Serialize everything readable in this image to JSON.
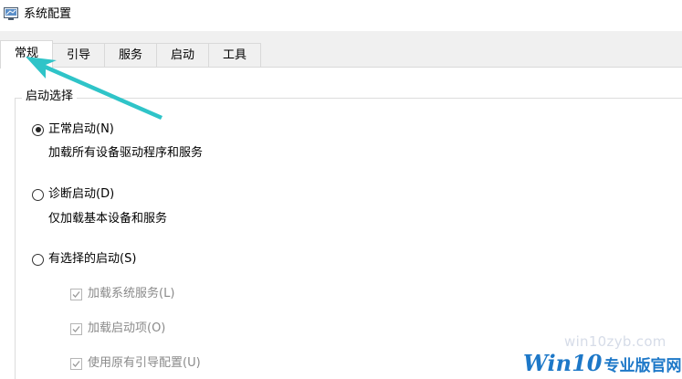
{
  "window": {
    "title": "系统配置",
    "icon": "system-config-icon"
  },
  "tabs": [
    {
      "label": "常规",
      "active": true
    },
    {
      "label": "引导",
      "active": false
    },
    {
      "label": "服务",
      "active": false
    },
    {
      "label": "启动",
      "active": false
    },
    {
      "label": "工具",
      "active": false
    }
  ],
  "startup_selection": {
    "legend": "启动选择",
    "options": [
      {
        "label": "正常启动(N)",
        "description": "加载所有设备驱动程序和服务",
        "selected": true
      },
      {
        "label": "诊断启动(D)",
        "description": "仅加载基本设备和服务",
        "selected": false
      },
      {
        "label": "有选择的启动(S)",
        "selected": false
      }
    ],
    "selective_items": [
      {
        "label": "加载系统服务(L)",
        "checked": true,
        "disabled": true
      },
      {
        "label": "加载启动项(O)",
        "checked": true,
        "disabled": true
      },
      {
        "label": "使用原有引导配置(U)",
        "checked": true,
        "disabled": true
      }
    ]
  },
  "watermark": {
    "url": "win10zyb.com",
    "brand_win": "Win10",
    "brand_text": "专业版官网"
  },
  "colors": {
    "accent_arrow": "#2fc4c8",
    "watermark_blue": "#1d78c8",
    "tabstrip_bg": "#f0f0f0"
  }
}
